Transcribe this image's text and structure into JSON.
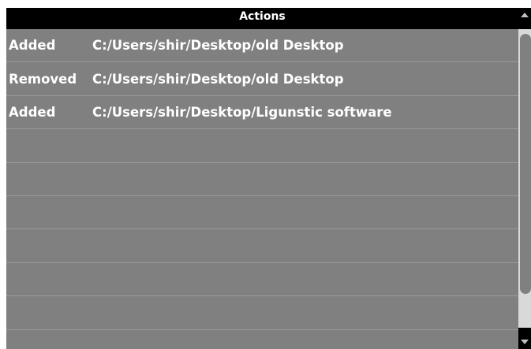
{
  "table": {
    "header": "Actions",
    "rows": [
      {
        "action": "Added",
        "path": "C:/Users/shir/Desktop/old Desktop"
      },
      {
        "action": "Removed",
        "path": "C:/Users/shir/Desktop/old Desktop"
      },
      {
        "action": "Added",
        "path": "C:/Users/shir/Desktop/Ligunstic software"
      },
      {
        "action": "",
        "path": ""
      },
      {
        "action": "",
        "path": ""
      },
      {
        "action": "",
        "path": ""
      },
      {
        "action": "",
        "path": ""
      },
      {
        "action": "",
        "path": ""
      },
      {
        "action": "",
        "path": ""
      },
      {
        "action": "",
        "path": ""
      }
    ]
  },
  "colors": {
    "header_bg": "#000000",
    "row_bg": "#808080",
    "row_divider": "#9a9a9a",
    "text": "#ffffff",
    "scrollbar_track": "#d9d9d9",
    "scrollbar_thumb": "#808080"
  },
  "icons": {
    "scroll_up": "scroll-up-arrow-icon",
    "scroll_down": "scroll-down-arrow-icon"
  }
}
